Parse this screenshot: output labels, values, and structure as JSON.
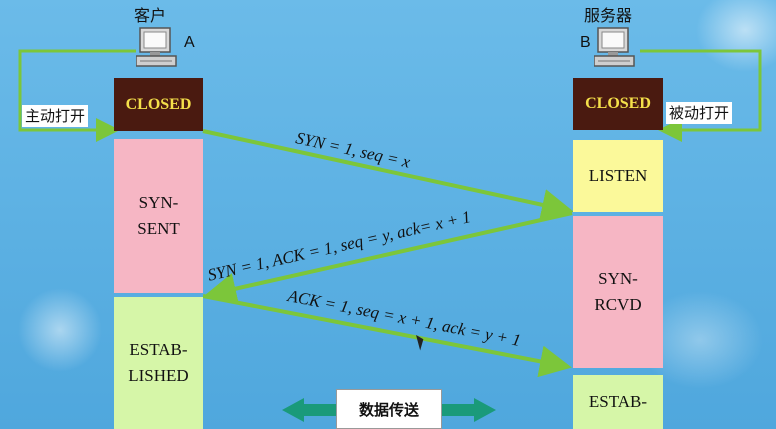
{
  "hosts": {
    "client": {
      "title": "客户",
      "letter": "A",
      "open_label": "主动打开"
    },
    "server": {
      "title": "服务器",
      "letter": "B",
      "open_label": "被动打开"
    }
  },
  "client_states": [
    "CLOSED",
    "SYN-\nSENT",
    "ESTAB-\nLISHED"
  ],
  "server_states": [
    "CLOSED",
    "LISTEN",
    "SYN-\nRCVD",
    "ESTAB-"
  ],
  "messages": [
    "SYN = 1, seq = x",
    "SYN = 1, ACK = 1, seq = y, ack= x + 1",
    "ACK = 1, seq = x + 1, ack = y + 1"
  ],
  "data_transfer": "数据传送",
  "colors": {
    "closed_bg": "#4a1a10",
    "closed_text": "#f5e04a",
    "syn_state": "#f6b6c4",
    "listen_state": "#fbf99a",
    "estab_state": "#d6f6a8",
    "arrow": "#7cc63a",
    "transfer_arrow": "#1a9a7a"
  },
  "icons": [
    "computer-icon",
    "computer-icon",
    "double-arrow-icon"
  ]
}
